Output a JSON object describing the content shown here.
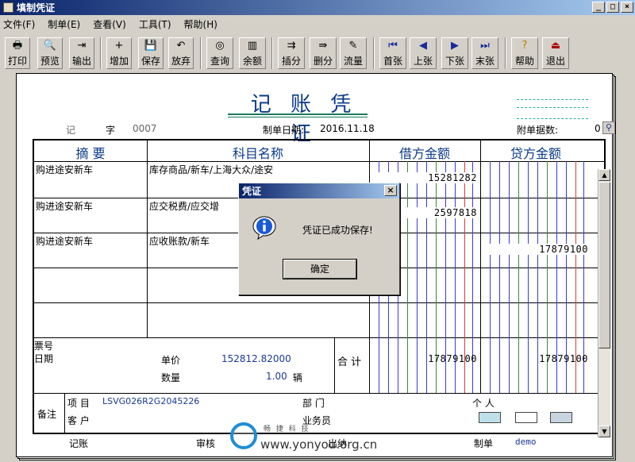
{
  "window": {
    "title": "填制凭证",
    "controls": [
      "_",
      "□",
      "×"
    ]
  },
  "menu": [
    "文件(F)",
    "制单(E)",
    "查看(V)",
    "工具(T)",
    "帮助(H)"
  ],
  "toolbar": [
    {
      "label": "打印",
      "icon": "printer-icon",
      "glyph": "🖶"
    },
    {
      "label": "预览",
      "icon": "preview-icon",
      "glyph": "🔍"
    },
    {
      "label": "输出",
      "icon": "export-icon",
      "glyph": "⇥"
    },
    {
      "label": "增加",
      "icon": "add-icon",
      "glyph": "+"
    },
    {
      "label": "保存",
      "icon": "save-icon",
      "glyph": "💾"
    },
    {
      "label": "放弃",
      "icon": "undo-icon",
      "glyph": "↶"
    },
    {
      "label": "查询",
      "icon": "binoculars-icon",
      "glyph": "◎"
    },
    {
      "label": "余额",
      "icon": "chart-icon",
      "glyph": "▥"
    },
    {
      "label": "插分",
      "icon": "insert-row-icon",
      "glyph": "⇉"
    },
    {
      "label": "删分",
      "icon": "delete-row-icon",
      "glyph": "⇛"
    },
    {
      "label": "流量",
      "icon": "pencil-icon",
      "glyph": "✎"
    },
    {
      "label": "首张",
      "icon": "first-icon",
      "glyph": "⏮"
    },
    {
      "label": "上张",
      "icon": "prev-icon",
      "glyph": "◀"
    },
    {
      "label": "下张",
      "icon": "next-icon",
      "glyph": "▶"
    },
    {
      "label": "末张",
      "icon": "last-icon",
      "glyph": "⏭"
    },
    {
      "label": "帮助",
      "icon": "help-icon",
      "glyph": "?"
    },
    {
      "label": "退出",
      "icon": "exit-icon",
      "glyph": "⏏"
    }
  ],
  "voucher": {
    "title": "记 账 凭 证",
    "type_label": "记",
    "word_label": "字",
    "number": "0007",
    "date_label": "制单日期:",
    "date": "2016.11.18",
    "attach_label": "附单据数:",
    "attach_count": "0",
    "headers": {
      "summary": "摘 要",
      "account": "科目名称",
      "debit": "借方金额",
      "credit": "贷方金额"
    },
    "rows": [
      {
        "summary": "购进途安新车",
        "account": "库存商品/新车/上海大众/途安",
        "debit": "15281282",
        "credit": ""
      },
      {
        "summary": "购进途安新车",
        "account": "应交税费/应交增",
        "debit": "2597818",
        "credit": ""
      },
      {
        "summary": "购进途安新车",
        "account": "应收账款/新车",
        "debit": "",
        "credit": "17879100"
      },
      {
        "summary": "",
        "account": "",
        "debit": "",
        "credit": ""
      },
      {
        "summary": "",
        "account": "",
        "debit": "",
        "credit": ""
      }
    ],
    "ticket_label": "票号",
    "date_row_label": "日期",
    "price_label": "单价",
    "price_value": "152812.82000",
    "qty_label": "数量",
    "qty_value": "1.00",
    "qty_unit": "辆",
    "total_label": "合 计",
    "total_debit": "17879100",
    "total_credit": "17879100",
    "remark_label": "备注",
    "project_label": "项 目",
    "project_value": "LSVG026R2G2045226",
    "dept_label": "部 门",
    "person_label": "个 人",
    "customer_label": "客 户",
    "salesman_label": "业务员",
    "bookkeeping_label": "记账",
    "audit_label": "审核",
    "cashier_label": "出纳",
    "maker_label": "制单",
    "maker_value": "demo"
  },
  "dialog": {
    "title": "凭证",
    "message": "凭证已成功保存!",
    "ok_label": "确定",
    "close_glyph": "×"
  },
  "watermark": {
    "url": "www.yonyou.org.cn",
    "sub": "畅 捷 科 技"
  }
}
